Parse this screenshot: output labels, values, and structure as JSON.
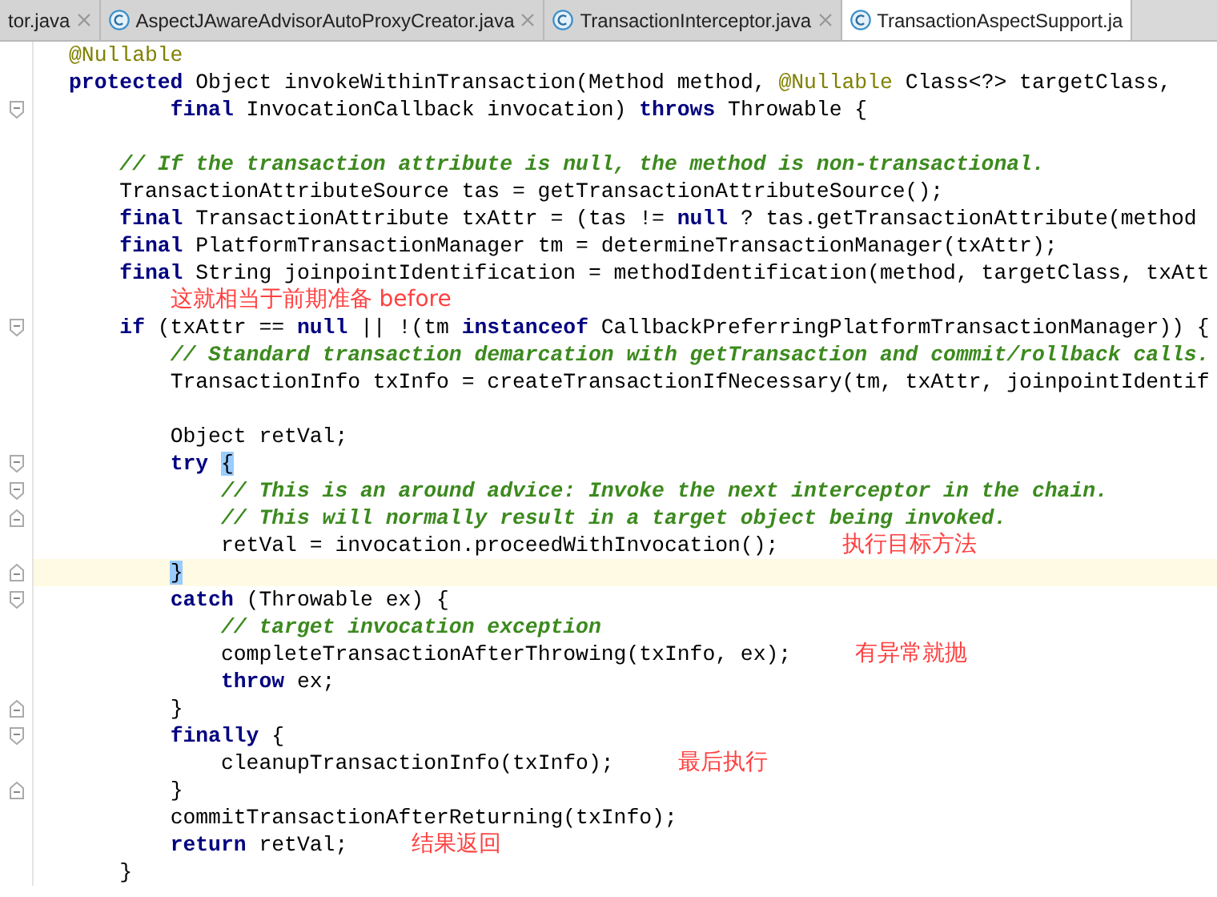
{
  "tabs": [
    {
      "label": "tor.java",
      "selected": false,
      "icon": false,
      "closable": true
    },
    {
      "label": "AspectJAwareAdvisorAutoProxyCreator.java",
      "selected": false,
      "icon": true,
      "closable": true
    },
    {
      "label": "TransactionInterceptor.java",
      "selected": false,
      "icon": true,
      "closable": true
    },
    {
      "label": "TransactionAspectSupport.ja",
      "selected": true,
      "icon": true,
      "closable": false
    }
  ],
  "lines": [
    {
      "kind": "code",
      "current": false,
      "fold_start": false,
      "fold_end": false,
      "segments": [
        {
          "annotation": "@Nullable"
        }
      ]
    },
    {
      "kind": "code",
      "current": false,
      "fold_start": false,
      "fold_end": false,
      "segments": [
        {
          "keyword": "protected"
        },
        {
          "code": " Object invokeWithinTransaction(Method method, "
        },
        {
          "annotation": "@Nullable"
        },
        {
          "code": " Class<?> targetClass,"
        }
      ],
      "children": [
        {
          "kind": "group",
          "children": [
            {
              "kind": "code",
              "current": false,
              "fold_start": true,
              "fold_end": false,
              "segments": [
                {
                  "keyword": "final"
                },
                {
                  "code": " InvocationCallback invocation) "
                },
                {
                  "keyword": "throws"
                },
                {
                  "code": " Throwable {"
                }
              ]
            }
          ]
        },
        {
          "kind": "blank"
        },
        {
          "kind": "code",
          "current": false,
          "fold_start": false,
          "fold_end": false,
          "segments": [
            {
              "comment": "// If the transaction attribute is null, the method is non-transactional."
            }
          ]
        },
        {
          "kind": "code",
          "current": false,
          "fold_start": false,
          "fold_end": false,
          "segments": [
            {
              "code": "TransactionAttributeSource tas = getTransactionAttributeSource();"
            }
          ]
        },
        {
          "kind": "code",
          "current": false,
          "fold_start": false,
          "fold_end": false,
          "segments": [
            {
              "keyword": "final"
            },
            {
              "code": " TransactionAttribute txAttr = (tas != "
            },
            {
              "keyword": "null"
            },
            {
              "code": " ? tas.getTransactionAttribute(method"
            }
          ]
        },
        {
          "kind": "code",
          "current": false,
          "fold_start": false,
          "fold_end": false,
          "segments": [
            {
              "keyword": "final"
            },
            {
              "code": " PlatformTransactionManager tm = determineTransactionManager(txAttr);"
            }
          ]
        },
        {
          "kind": "code",
          "current": false,
          "fold_start": false,
          "fold_end": false,
          "segments": [
            {
              "keyword": "final"
            },
            {
              "code": " String joinpointIdentification = methodIdentification(method, targetClass, txAtt"
            }
          ]
        },
        {
          "kind": "group",
          "children": [
            {
              "kind": "note",
              "note": "这就相当于前期准备 before"
            }
          ]
        },
        {
          "kind": "code",
          "current": false,
          "fold_start": true,
          "fold_end": false,
          "segments": [
            {
              "keyword": "if"
            },
            {
              "code": " (txAttr == "
            },
            {
              "keyword": "null"
            },
            {
              "code": " || !(tm "
            },
            {
              "keyword": "instanceof"
            },
            {
              "code": " CallbackPreferringPlatformTransactionManager)) {"
            }
          ],
          "children": [
            {
              "kind": "code",
              "current": false,
              "fold_start": false,
              "fold_end": false,
              "segments": [
                {
                  "comment": "// Standard transaction demarcation with getTransaction and commit/rollback calls."
                }
              ]
            },
            {
              "kind": "code",
              "current": false,
              "fold_start": false,
              "fold_end": false,
              "segments": [
                {
                  "code": "TransactionInfo txInfo = createTransactionIfNecessary(tm, txAttr, joinpointIdentif"
                }
              ]
            },
            {
              "kind": "blank"
            },
            {
              "kind": "code",
              "current": false,
              "fold_start": false,
              "fold_end": false,
              "segments": [
                {
                  "code": "Object retVal;"
                }
              ]
            },
            {
              "kind": "code",
              "current": false,
              "fold_start": true,
              "fold_end": false,
              "segments": [
                {
                  "keyword": "try "
                },
                {
                  "brace": "{"
                }
              ],
              "children": [
                {
                  "kind": "code",
                  "current": false,
                  "fold_start": true,
                  "fold_end": false,
                  "segments": [
                    {
                      "comment": "// This is an around advice: Invoke the next interceptor in the chain."
                    }
                  ]
                },
                {
                  "kind": "code",
                  "current": false,
                  "fold_start": false,
                  "fold_end": true,
                  "segments": [
                    {
                      "comment": "// This will normally result in a target object being invoked."
                    }
                  ]
                },
                {
                  "kind": "code",
                  "current": false,
                  "fold_start": false,
                  "fold_end": false,
                  "segments": [
                    {
                      "code": "retVal = invocation.proceedWithInvocation();"
                    }
                  ],
                  "note": "执行目标方法"
                }
              ]
            },
            {
              "kind": "code",
              "current": true,
              "fold_start": false,
              "fold_end": true,
              "segments": [
                {
                  "brace": "}"
                }
              ]
            },
            {
              "kind": "code",
              "current": false,
              "fold_start": true,
              "fold_end": false,
              "segments": [
                {
                  "keyword": "catch"
                },
                {
                  "code": " (Throwable ex) {"
                }
              ],
              "children": [
                {
                  "kind": "code",
                  "current": false,
                  "fold_start": false,
                  "fold_end": false,
                  "segments": [
                    {
                      "comment": "// target invocation exception"
                    }
                  ]
                },
                {
                  "kind": "code",
                  "current": false,
                  "fold_start": false,
                  "fold_end": false,
                  "segments": [
                    {
                      "code": "completeTransactionAfterThrowing(txInfo, ex);"
                    }
                  ],
                  "note": "有异常就抛"
                },
                {
                  "kind": "code",
                  "current": false,
                  "fold_start": false,
                  "fold_end": false,
                  "segments": [
                    {
                      "keyword": "throw"
                    },
                    {
                      "code": " ex;"
                    }
                  ]
                }
              ]
            },
            {
              "kind": "code",
              "current": false,
              "fold_start": false,
              "fold_end": true,
              "segments": [
                {
                  "code": "}"
                }
              ]
            },
            {
              "kind": "code",
              "current": false,
              "fold_start": true,
              "fold_end": false,
              "segments": [
                {
                  "keyword": "finally"
                },
                {
                  "code": " {"
                }
              ],
              "children": [
                {
                  "kind": "code",
                  "current": false,
                  "fold_start": false,
                  "fold_end": false,
                  "segments": [
                    {
                      "code": "cleanupTransactionInfo(txInfo);"
                    }
                  ],
                  "note": "最后执行"
                }
              ]
            },
            {
              "kind": "code",
              "current": false,
              "fold_start": false,
              "fold_end": true,
              "segments": [
                {
                  "code": "}"
                }
              ]
            },
            {
              "kind": "code",
              "current": false,
              "fold_start": false,
              "fold_end": false,
              "segments": [
                {
                  "code": "commitTransactionAfterReturning(txInfo);"
                }
              ]
            },
            {
              "kind": "code",
              "current": false,
              "fold_start": false,
              "fold_end": false,
              "segments": [
                {
                  "keyword": "return"
                },
                {
                  "code": " retVal;"
                }
              ],
              "note": "结果返回"
            }
          ]
        },
        {
          "kind": "code",
          "current": false,
          "fold_start": false,
          "fold_end": false,
          "segments": [
            {
              "code": "}"
            }
          ]
        }
      ]
    }
  ]
}
